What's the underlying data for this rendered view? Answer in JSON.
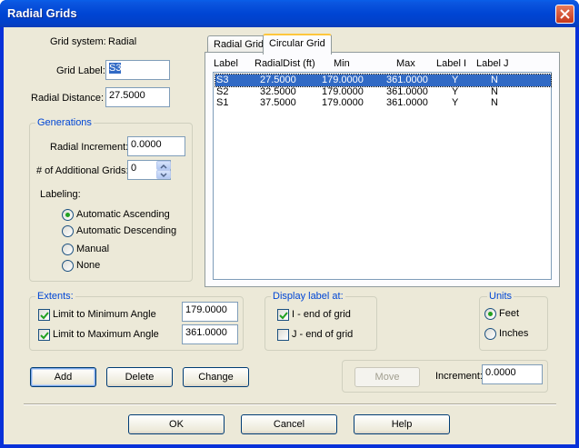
{
  "window": {
    "title": "Radial Grids"
  },
  "grid_system": {
    "label": "Grid system:",
    "value": "Radial"
  },
  "grid_label": {
    "label": "Grid Label:",
    "value": "S3"
  },
  "radial_distance": {
    "label": "Radial Distance:",
    "value": "27.5000"
  },
  "generations": {
    "title": "Generations",
    "radial_increment": {
      "label": "Radial Increment:",
      "value": "0.0000"
    },
    "additional_grids": {
      "label": "# of Additional Grids:",
      "value": "0"
    },
    "labeling": {
      "label": "Labeling:",
      "options": [
        "Automatic Ascending",
        "Automatic Descending",
        "Manual",
        "None"
      ],
      "selected": "Automatic Ascending"
    }
  },
  "tabs": [
    {
      "label": "Radial Grid",
      "active": false
    },
    {
      "label": "Circular Grid",
      "active": true
    }
  ],
  "grid_table": {
    "headers": [
      "Label",
      "RadialDist (ft)",
      "Min",
      "Max",
      "Label I",
      "Label J"
    ],
    "rows": [
      [
        "S3",
        "27.5000",
        "179.0000",
        "361.0000",
        "Y",
        "N"
      ],
      [
        "S2",
        "32.5000",
        "179.0000",
        "361.0000",
        "Y",
        "N"
      ],
      [
        "S1",
        "37.5000",
        "179.0000",
        "361.0000",
        "Y",
        "N"
      ]
    ],
    "selected_row": "S3"
  },
  "extents": {
    "title": "Extents:",
    "min_angle": {
      "label": "Limit to Minimum Angle",
      "checked": true,
      "value": "179.0000"
    },
    "max_angle": {
      "label": "Limit to Maximum Angle",
      "checked": true,
      "value": "361.0000"
    }
  },
  "display_label": {
    "title": "Display label at:",
    "i_end": {
      "label": "I - end of grid",
      "checked": true
    },
    "j_end": {
      "label": "J - end of grid",
      "checked": false
    }
  },
  "units": {
    "title": "Units",
    "options": [
      "Feet",
      "Inches"
    ],
    "selected": "Feet"
  },
  "actions": {
    "add": "Add",
    "delete": "Delete",
    "change": "Change",
    "move": "Move",
    "increment_label": "Increment:",
    "increment_value": "0.0000"
  },
  "footer": {
    "ok": "OK",
    "cancel": "Cancel",
    "help": "Help"
  },
  "icons": {
    "close": "close-icon",
    "check": "checkmark-icon",
    "spin_up": "chevron-up-icon",
    "spin_down": "chevron-down-icon"
  }
}
